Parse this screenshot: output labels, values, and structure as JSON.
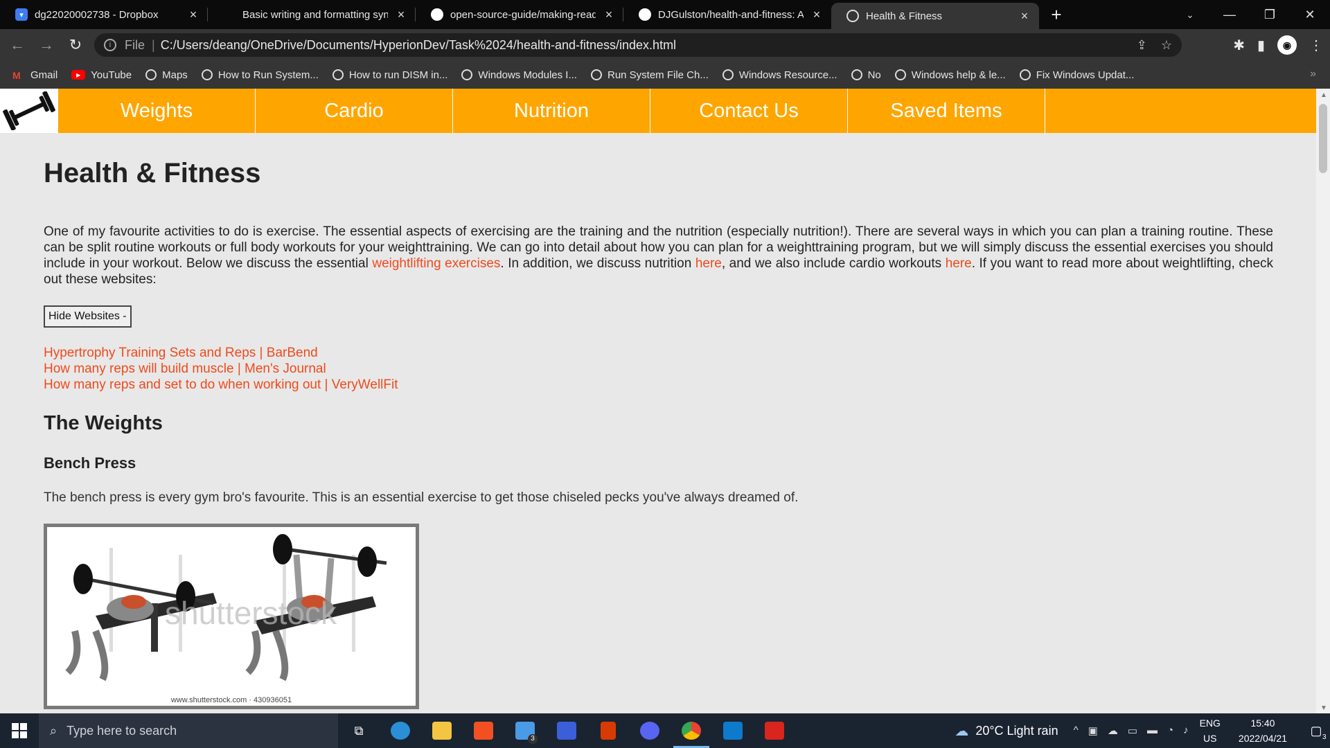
{
  "browser": {
    "tabs": [
      {
        "title": "dg22020002738 - Dropbox",
        "icon": "dropbox-icon"
      },
      {
        "title": "Basic writing and formatting synt",
        "icon": "none"
      },
      {
        "title": "open-source-guide/making-read",
        "icon": "github-icon"
      },
      {
        "title": "DJGulston/health-and-fitness: A",
        "icon": "github-icon"
      },
      {
        "title": "Health & Fitness",
        "icon": "globe-icon",
        "active": true
      }
    ],
    "address": {
      "protocol": "File",
      "url": "C:/Users/deang/OneDrive/Documents/HyperionDev/Task%2024/health-and-fitness/index.html"
    },
    "bookmarks": [
      {
        "label": "Gmail",
        "icon": "gmail-icon"
      },
      {
        "label": "YouTube",
        "icon": "youtube-icon"
      },
      {
        "label": "Maps",
        "icon": "globe-icon"
      },
      {
        "label": "How to Run System...",
        "icon": "globe-icon"
      },
      {
        "label": "How to run DISM in...",
        "icon": "globe-icon"
      },
      {
        "label": "Windows Modules I...",
        "icon": "globe-icon"
      },
      {
        "label": "Run System File Ch...",
        "icon": "globe-icon"
      },
      {
        "label": "Windows Resource...",
        "icon": "globe-icon"
      },
      {
        "label": "No",
        "icon": "globe-icon"
      },
      {
        "label": "Windows help & le...",
        "icon": "globe-icon"
      },
      {
        "label": "Fix Windows Updat...",
        "icon": "globe-icon"
      }
    ],
    "more_bookmarks": "»"
  },
  "site": {
    "nav": [
      "Weights",
      "Cardio",
      "Nutrition",
      "Contact Us",
      "Saved Items"
    ],
    "title": "Health & Fitness",
    "intro": {
      "part1": "One of my favourite activities to do is exercise. The essential aspects of exercising are the training and the nutrition (especially nutrition!). There are several ways in which you can plan a training routine. These can be split routine workouts or full body workouts for your weighttraining. We can go into detail about how you can plan for a weighttraining program, but we will simply discuss the essential exercises you should include in your workout. Below we discuss the essential ",
      "link1": "weightlifting exercises",
      "part2": ". In addition, we discuss nutrition ",
      "link2": "here",
      "part3": ", and we also include cardio workouts ",
      "link3": "here",
      "part4": ". If you want to read more about weightlifting, check out these websites:"
    },
    "toggle_button": "Hide Websites -",
    "website_links": [
      "Hypertrophy Training Sets and Reps | BarBend",
      "How many reps will build muscle | Men's Journal",
      "How many reps and set to do when working out | VeryWellFit"
    ],
    "weights_heading": "The Weights",
    "bench_heading": "Bench Press",
    "bench_text": "The bench press is every gym bro's favourite. This is an essential exercise to get those chiseled pecks you've always dreamed of.",
    "image_watermark": "shutterstock",
    "image_caption": "www.shutterstock.com · 430936051"
  },
  "taskbar": {
    "search_placeholder": "Type here to search",
    "mail_badge": "3",
    "weather": "20°C  Light rain",
    "lang_top": "ENG",
    "lang_bottom": "US",
    "time": "15:40",
    "date": "2022/04/21",
    "notification_count": "3"
  },
  "colors": {
    "nav_bg": "#ffa500",
    "link": "#f04a1c",
    "page_bg": "#e8e8e8"
  }
}
